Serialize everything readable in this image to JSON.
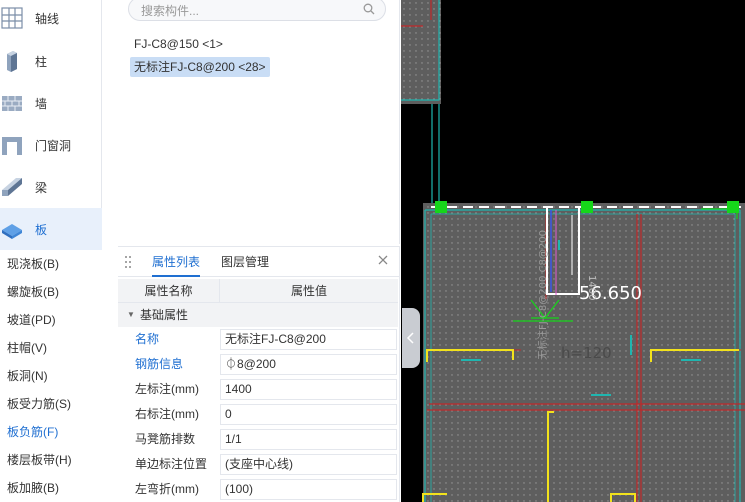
{
  "nav_categories": [
    {
      "label": "轴线",
      "icon": "grid-axis-icon"
    },
    {
      "label": "柱",
      "icon": "column-icon"
    },
    {
      "label": "墙",
      "icon": "wall-icon"
    },
    {
      "label": "门窗洞",
      "icon": "door-window-icon"
    },
    {
      "label": "梁",
      "icon": "beam-icon"
    },
    {
      "label": "板",
      "icon": "slab-icon",
      "selected": true
    }
  ],
  "slab_types": [
    {
      "label": "现浇板(B)"
    },
    {
      "label": "螺旋板(B)"
    },
    {
      "label": "坡道(PD)"
    },
    {
      "label": "柱帽(V)"
    },
    {
      "label": "板洞(N)"
    },
    {
      "label": "板受力筋(S)"
    },
    {
      "label": "板负筋(F)",
      "selected": true
    },
    {
      "label": "楼层板带(H)"
    },
    {
      "label": "板加腋(B)"
    }
  ],
  "component_list": {
    "search_placeholder": "搜索构件...",
    "items": [
      {
        "label": "FJ-C8@150 <1>"
      },
      {
        "label": "无标注FJ-C8@200 <28>",
        "selected": true
      }
    ]
  },
  "property_panel": {
    "tabs": [
      "属性列表",
      "图层管理"
    ],
    "active_tab": "属性列表",
    "col_name": "属性名称",
    "col_value": "属性值",
    "group": "基础属性",
    "rows": [
      {
        "name": "名称",
        "value": "无标注FJ-C8@200",
        "link": true
      },
      {
        "name": "钢筋信息",
        "value": "⏀8@200",
        "link": true
      },
      {
        "name": "左标注(mm)",
        "value": "1400"
      },
      {
        "name": "右标注(mm)",
        "value": "0"
      },
      {
        "name": "马凳筋排数",
        "value": "1/1"
      },
      {
        "name": "单边标注位置",
        "value": "(支座中心线)"
      },
      {
        "name": "左弯折(mm)",
        "value": "(100)"
      }
    ]
  },
  "cad": {
    "elevation_text": "56.650",
    "rebar_label_vertical": "无标注FJ-C8@200 C8@200",
    "dim_1400": "1400",
    "label_120": "h=120",
    "colors": {
      "background": "#000000",
      "slab_fill": "#5e5e5e",
      "cyan": "#1fb6b0",
      "red": "#c0282a",
      "yellow": "#f2e21c",
      "green": "#16d61a"
    }
  }
}
